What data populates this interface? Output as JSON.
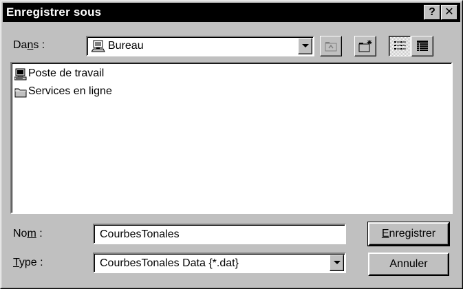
{
  "window": {
    "title": "Enregistrer sous",
    "help_label": "?",
    "close_label": "✕"
  },
  "location": {
    "label_pre": "Da",
    "label_accel": "n",
    "label_post": "s :",
    "current": "Bureau",
    "icon": "desktop-icon"
  },
  "toolbar": {
    "buttons": [
      {
        "name": "up-one-level",
        "icon": "up-folder-icon"
      },
      {
        "name": "create-new-folder",
        "icon": "new-folder-icon"
      },
      {
        "name": "list-view",
        "icon": "list-view-icon",
        "pressed": true
      },
      {
        "name": "details-view",
        "icon": "details-view-icon",
        "pressed": false
      }
    ]
  },
  "files": [
    {
      "label": "Poste de travail",
      "icon": "my-computer-icon"
    },
    {
      "label": "Services en ligne",
      "icon": "folder-icon"
    }
  ],
  "filename": {
    "label_pre": "No",
    "label_accel": "m",
    "label_post": " :",
    "value": "CourbesTonales"
  },
  "filetype": {
    "label_accel": "T",
    "label_post": "ype :",
    "value": "CourbesTonales Data {*.dat}"
  },
  "buttons": {
    "save_accel": "E",
    "save_rest": "nregistrer",
    "cancel": "Annuler"
  },
  "colors": {
    "titlebar": "#000000",
    "face": "#c0c0c0"
  }
}
